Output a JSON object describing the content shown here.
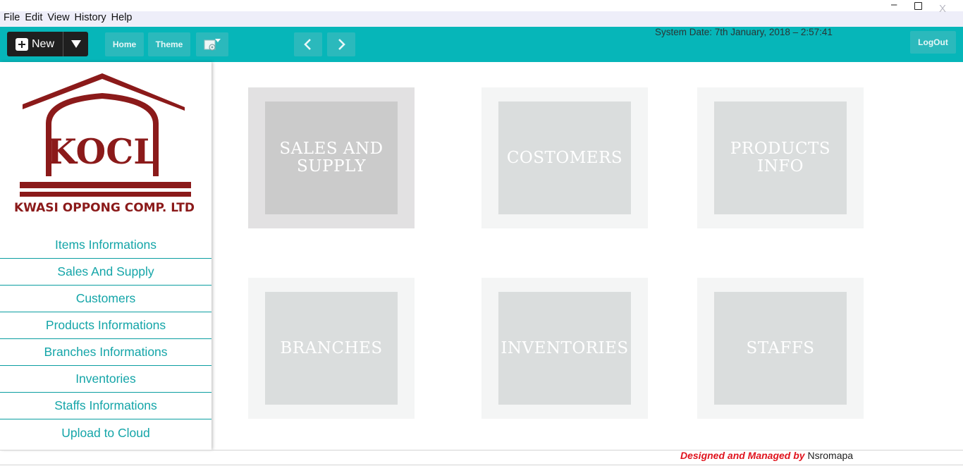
{
  "menubar": {
    "items": [
      {
        "label": "File"
      },
      {
        "label": "Edit"
      },
      {
        "label": "View"
      },
      {
        "label": "History"
      },
      {
        "label": "Help"
      }
    ],
    "window_controls": {
      "minimize": "–",
      "close": "X"
    }
  },
  "toolbar": {
    "new_label": "New",
    "home_label": "Home",
    "theme_label": "Theme",
    "system_date": "System Date: 7th January, 2018 – 2:57:41",
    "logout_label": "LogOut",
    "icons": {
      "new": "plus-icon",
      "dropdown": "triangle-down-icon",
      "screenshot": "screen-settings-icon",
      "back": "chevron-left-icon",
      "forward": "chevron-right-icon"
    },
    "accent_color": "#06b6b9"
  },
  "logo": {
    "abbr": "KOCL",
    "company": "KWASI OPPONG COMP. LTD",
    "color": "#8b1a1a"
  },
  "sidebar": {
    "items": [
      {
        "label": "Items Informations"
      },
      {
        "label": "Sales And Supply"
      },
      {
        "label": "Customers"
      },
      {
        "label": "Products Informations"
      },
      {
        "label": "Branches Informations"
      },
      {
        "label": "Inventories"
      },
      {
        "label": "Staffs Informations"
      },
      {
        "label": "Upload to Cloud"
      }
    ],
    "text_color": "#14a5a8"
  },
  "tiles": [
    {
      "label": "SALES AND SUPPLY",
      "active": true
    },
    {
      "label": "COSTOMERS",
      "active": false
    },
    {
      "label": "PRODUCTS INFO",
      "active": false
    },
    {
      "label": "BRANCHES",
      "active": false
    },
    {
      "label": "INVENTORIES",
      "active": false
    },
    {
      "label": "STAFFS",
      "active": false
    }
  ],
  "footer": {
    "credit_lead": "Designed and Managed by",
    "credit_name": "Nsromapa"
  }
}
